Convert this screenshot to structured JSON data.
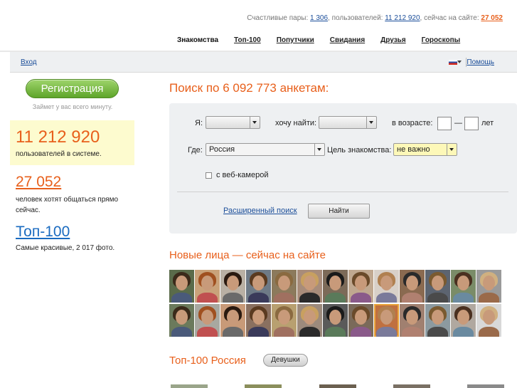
{
  "stats": {
    "pairs_label": "Счастливые пары:",
    "pairs_value": "1 306",
    "users_label": ", пользователей:",
    "users_value": "11 212 920",
    "online_label": ", сейчас на сайте:",
    "online_value": "27 052"
  },
  "nav": {
    "tabs": [
      "Знакомства",
      "Топ-100",
      "Попутчики",
      "Свидания",
      "Друзья",
      "Гороскопы"
    ],
    "active": "Знакомства"
  },
  "subbar": {
    "login": "Вход",
    "help": "Помощь",
    "lang_icon": "russia-flag-icon"
  },
  "sidebar": {
    "register": "Регистрация",
    "register_note": "Займет у вас всего минуту.",
    "users_count": "11 212 920",
    "users_text": "пользователей в системе.",
    "online_count": "27 052",
    "online_text": "человек хотят общаться прямо сейчас.",
    "top_title": "Топ-100",
    "top_text": "Самые красивые, 2 017 фото."
  },
  "search": {
    "title": "Поиск по 6 092 773 анкетам:",
    "i_label": "Я:",
    "i_value": "",
    "want_label": "хочу найти:",
    "want_value": "",
    "age_label": "в возрасте:",
    "age_dash": "—",
    "age_unit": "лет",
    "where_label": "Где:",
    "where_value": "Россия",
    "goal_label": "Цель знакомства:",
    "goal_value": "не важно",
    "webcam_label": "с веб-камерой",
    "advanced": "Расширенный поиск",
    "find": "Найти"
  },
  "faces": {
    "title": "Новые лица — сейчас на сайте",
    "count": 26
  },
  "top100": {
    "title": "Топ-100 Россия",
    "filter": "Девушки"
  },
  "colors": {
    "accent": "#e8601c",
    "link": "#1a4d99",
    "highlight_bg": "#fdfbcf"
  }
}
